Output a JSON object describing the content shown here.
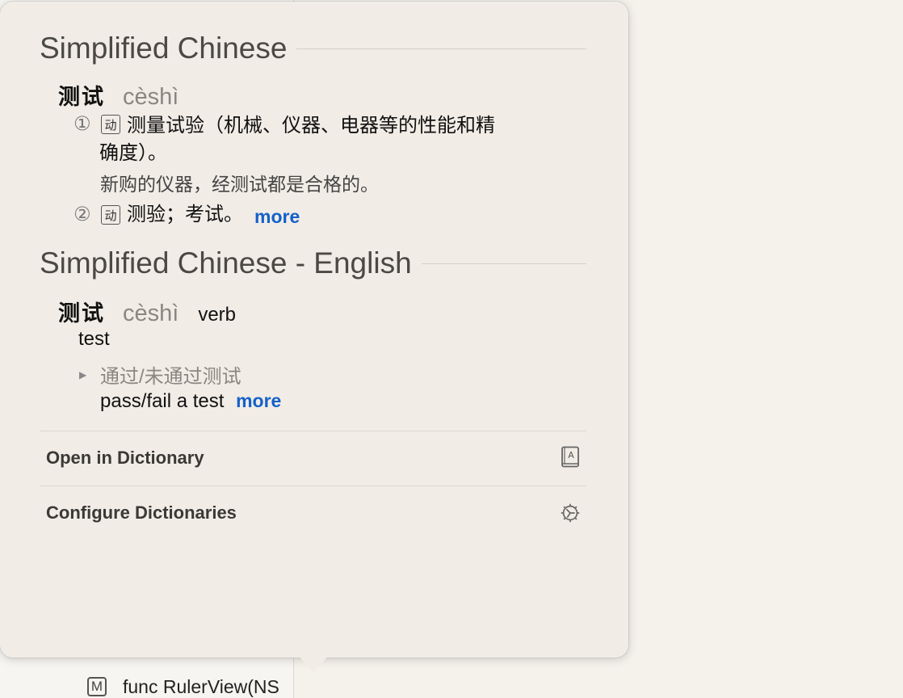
{
  "popover": {
    "section1": {
      "title": "Simplified Chinese",
      "headword": "测试",
      "pinyin": "cèshì",
      "senses": [
        {
          "num": "①",
          "tag": "动",
          "definition_line1": "测量试验（机械、仪器、电器等的性能和精",
          "definition_line2": "确度）。",
          "example": "新购的仪器，经测试都是合格的。"
        },
        {
          "num": "②",
          "tag": "动",
          "definition": "测验；考试。",
          "more": "more"
        }
      ]
    },
    "section2": {
      "title": "Simplified Chinese - English",
      "headword": "测试",
      "pinyin": "cèshì",
      "pos": "verb",
      "translation": "test",
      "example_cn": "通过/未通过测试",
      "example_en": "pass/fail a test",
      "more": "more"
    },
    "actions": {
      "open": {
        "label": "Open in Dictionary",
        "icon": "dictionary-book-icon"
      },
      "configure": {
        "label": "Configure Dictionaries",
        "icon": "gear-icon"
      }
    }
  },
  "background": {
    "code_badge": "M",
    "code_text": "func RulerView(NS"
  },
  "colors": {
    "link": "#1461c8",
    "popover_bg": "#f1ece6"
  }
}
